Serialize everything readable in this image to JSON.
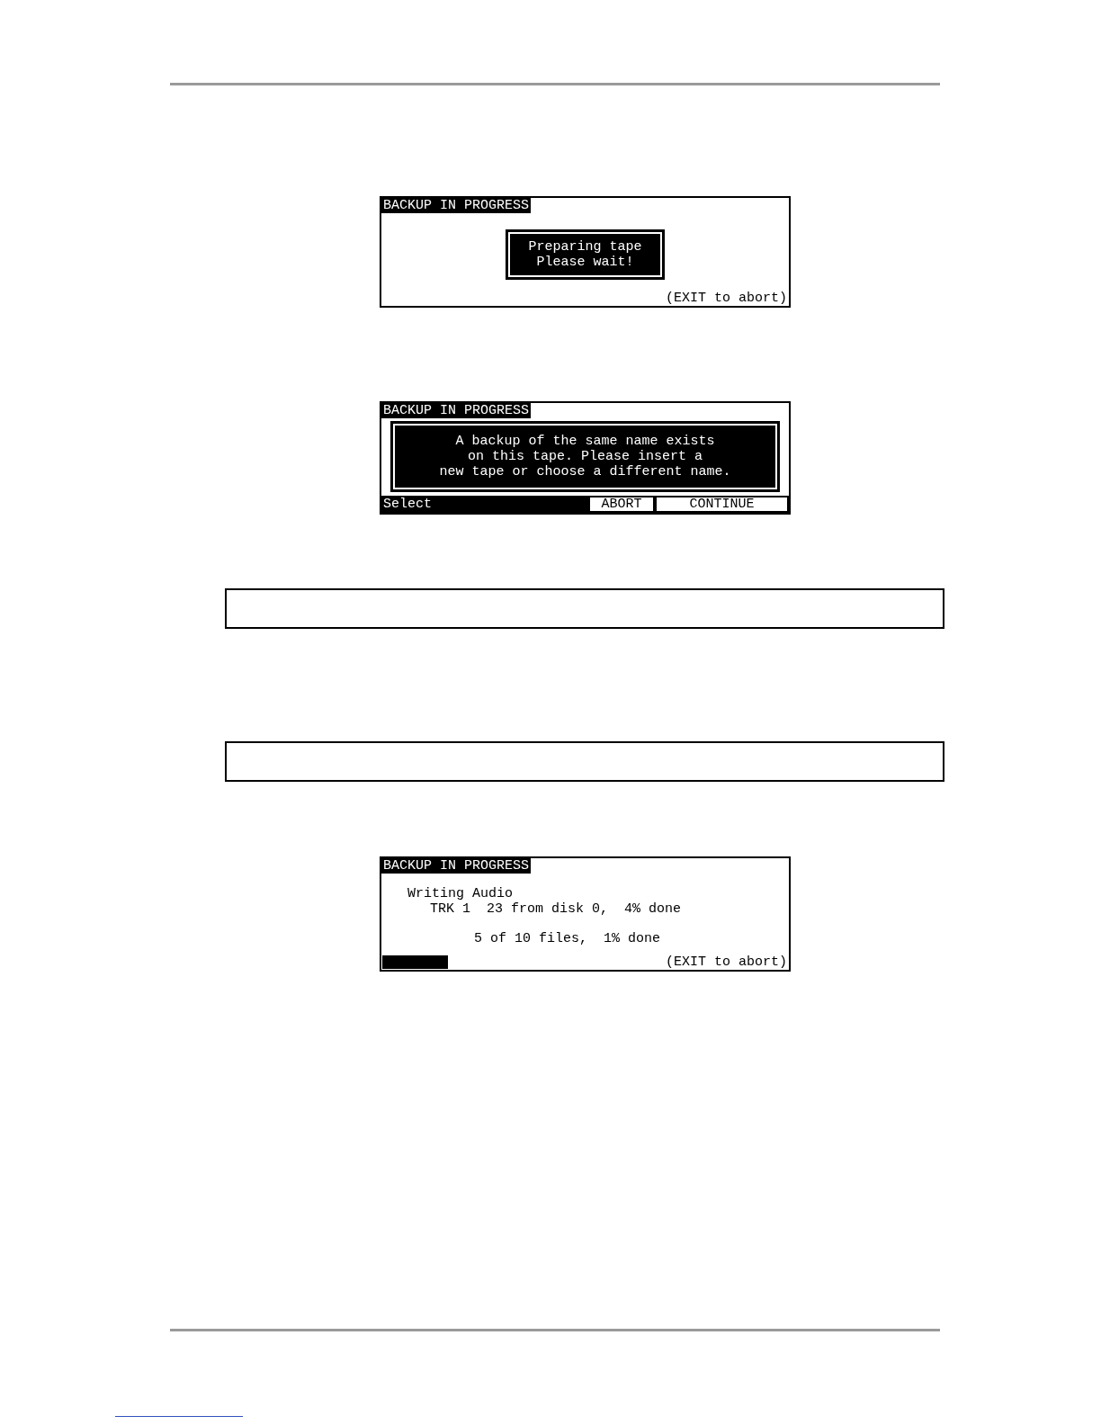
{
  "screens": [
    {
      "kind": "message",
      "title": "BACKUP IN PROGRESS",
      "message": [
        "Preparing tape",
        "Please wait!"
      ],
      "footer": "(EXIT to abort)"
    },
    {
      "kind": "prompt",
      "title": "BACKUP IN PROGRESS",
      "message": [
        "A backup of the same name exists",
        "on this tape. Please insert a",
        "new tape or choose a different name."
      ],
      "prompt": "Select",
      "buttons": [
        "ABORT",
        "CONTINUE"
      ]
    },
    {
      "kind": "status",
      "title": "BACKUP IN PROGRESS",
      "heading": "Writing Audio",
      "track": "TRK 1",
      "detail": "23 from disk 0,  4% done",
      "files": "5 of 10 files,  1% done",
      "footer": "(EXIT to abort)"
    }
  ]
}
